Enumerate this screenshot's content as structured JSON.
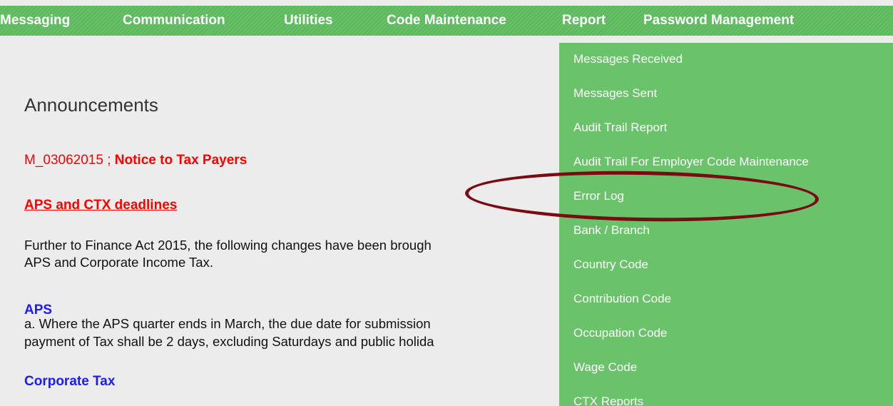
{
  "nav": {
    "items": [
      "Messaging",
      "Communication",
      "Utilities",
      "Code Maintenance",
      "Report",
      "Password Management"
    ]
  },
  "announcements": {
    "title": "Announcements",
    "notice_id": "M_03062015 ; ",
    "notice_title": "Notice to Tax Payers",
    "link": "APS and CTX deadlines",
    "intro_line1": "Further to Finance Act 2015, the following changes have been brough",
    "intro_line2": "APS and Corporate Income Tax.",
    "aps_heading": "APS",
    "aps_line1": "a. Where the APS quarter ends in March, the due date for submission",
    "aps_line2": "payment of Tax shall be 2 days, excluding Saturdays and public holida",
    "corporate_heading": "Corporate Tax"
  },
  "report_menu": {
    "items": [
      "Messages Received",
      "Messages Sent",
      "Audit Trail Report",
      "Audit Trail For Employer Code Maintenance",
      "Error Log",
      "Bank / Branch",
      "Country Code",
      "Contribution Code",
      "Occupation Code",
      "Wage Code",
      "CTX Reports"
    ],
    "highlighted": "Error Log"
  },
  "colors": {
    "nav_green": "#5cb85c",
    "menu_green": "#6ac36a",
    "notice_red": "#ff0000",
    "heading_blue": "#1a1aff",
    "highlight_ellipse": "#7a0a14"
  }
}
